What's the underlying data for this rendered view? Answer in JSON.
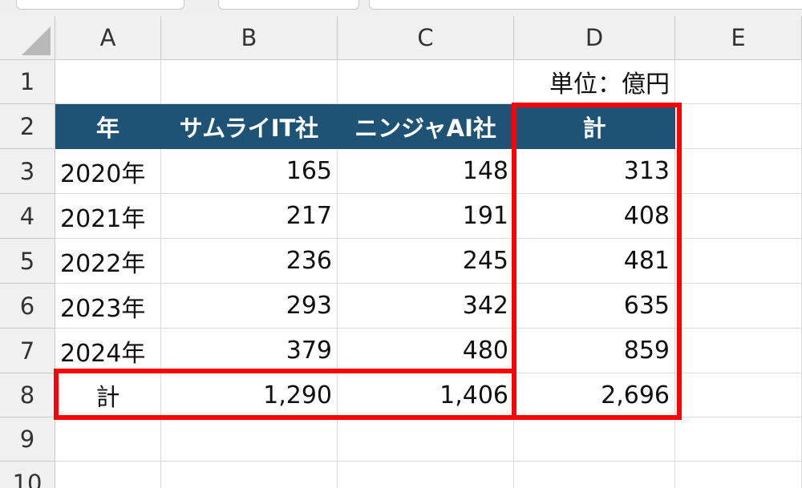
{
  "columns": [
    "A",
    "B",
    "C",
    "D",
    "E"
  ],
  "rows": [
    "1",
    "2",
    "3",
    "4",
    "5",
    "6",
    "7",
    "8",
    "9",
    "10"
  ],
  "unit_note": "単位：億円",
  "headers": [
    "年",
    "サムライIT社",
    "ニンジャAI社",
    "計"
  ],
  "data_rows": [
    {
      "year": "2020年",
      "samurai": "165",
      "ninja": "148",
      "total": "313"
    },
    {
      "year": "2021年",
      "samurai": "217",
      "ninja": "191",
      "total": "408"
    },
    {
      "year": "2022年",
      "samurai": "236",
      "ninja": "245",
      "total": "481"
    },
    {
      "year": "2023年",
      "samurai": "293",
      "ninja": "342",
      "total": "635"
    },
    {
      "year": "2024年",
      "samurai": "379",
      "ninja": "480",
      "total": "859"
    }
  ],
  "total_row": {
    "label": "計",
    "samurai": "1,290",
    "ninja": "1,406",
    "total": "2,696"
  },
  "colors": {
    "header_fill": "#1f5376",
    "header_text": "#ffffff",
    "highlight": "#ff0000",
    "gridline": "#d9d9d9",
    "heading_fill": "#f0f0f0"
  }
}
